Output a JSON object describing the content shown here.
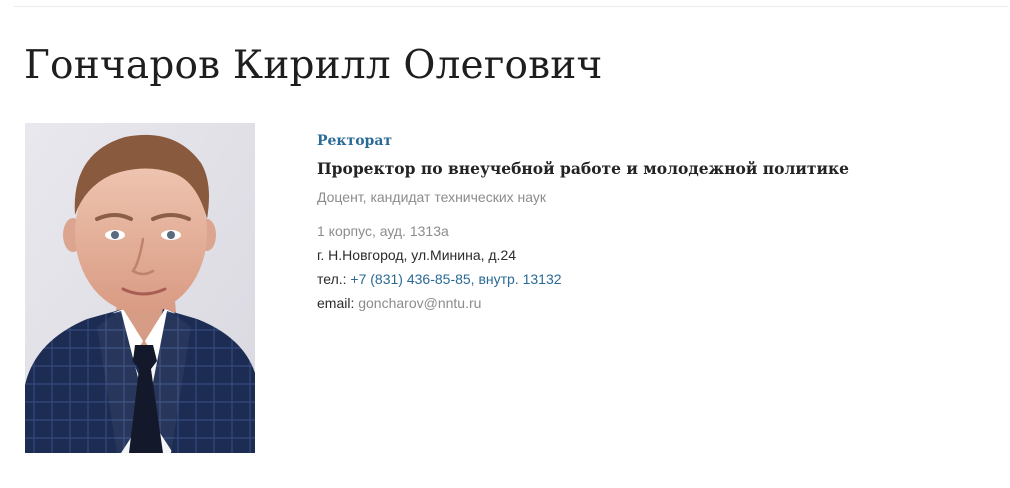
{
  "person": {
    "name": "Гончаров Кирилл Олегович",
    "department": "Ректорат",
    "position": "Проректор по внеучебной работе и молодежной политике",
    "degree": "Доцент, кандидат технических наук",
    "room": "1 корпус, ауд. 1313а",
    "address": "г. Н.Новгород, ул.Минина, д.24",
    "phone_label": "тел.:",
    "phone": "+7 (831) 436-85-85, внутр. 13132",
    "email_label": "email:",
    "email": "goncharov@nntu.ru"
  },
  "colors": {
    "link": "#2a6a96",
    "muted": "#8c8c8c",
    "text": "#232323"
  }
}
